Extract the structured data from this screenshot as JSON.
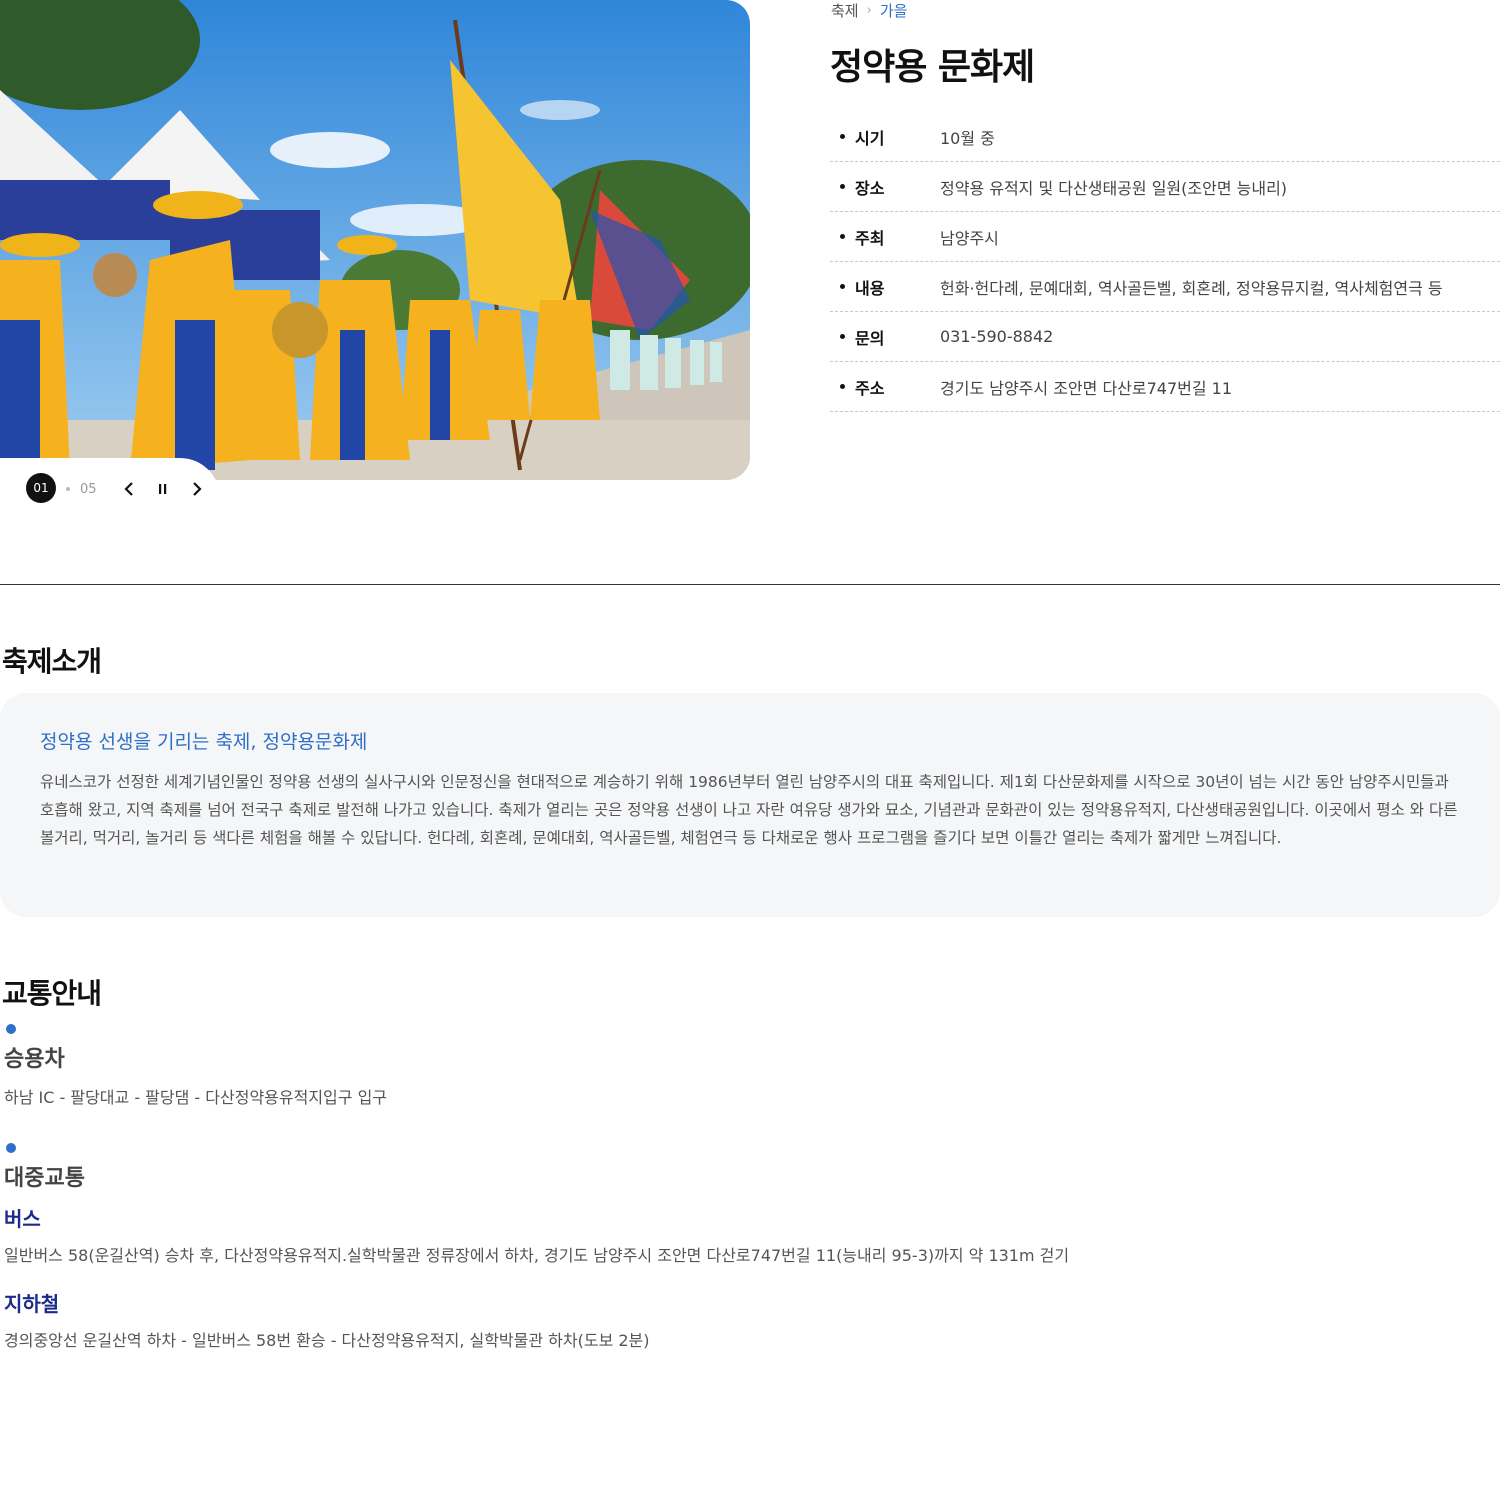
{
  "slider": {
    "current": "01",
    "total": "05",
    "prev_icon": "chevron-left-icon",
    "pause_icon": "pause-icon",
    "next_icon": "chevron-right-icon"
  },
  "breadcrumb": {
    "parent": "축제",
    "current": "가을"
  },
  "title": "정약용 문화제",
  "info": [
    {
      "label": "시기",
      "value": "10월 중"
    },
    {
      "label": "장소",
      "value": "정약용 유적지 및 다산생태공원 일원(조안면 능내리)"
    },
    {
      "label": "주최",
      "value": "남양주시"
    },
    {
      "label": "내용",
      "value": "헌화·헌다례, 문예대회, 역사골든벨, 회혼례, 정약용뮤지컬, 역사체험연극 등"
    },
    {
      "label": "문의",
      "value": "031-590-8842"
    },
    {
      "label": "주소",
      "value": "경기도 남양주시 조안면 다산로747번길 11"
    }
  ],
  "intro": {
    "section_title": "축제소개",
    "heading": "정약용 선생을 기리는 축제, 정약용문화제",
    "text": "유네스코가 선정한 세계기념인물인 정약용 선생의 실사구시와 인문정신을 현대적으로 계승하기 위해 1986년부터 열린 남양주시의 대표 축제입니다. 제1회 다산문화제를 시작으로 30년이 넘는 시간 동안 남양주시민들과 호흡해 왔고, 지역 축제를 넘어 전국구 축제로 발전해 나가고 있습니다. 축제가 열리는 곳은 정약용 선생이 나고 자란 여유당 생가와 묘소, 기념관과 문화관이 있는 정약용유적지, 다산생태공원입니다. 이곳에서 평소 와 다른 볼거리, 먹거리, 놀거리 등 색다른 체험을 해볼 수 있답니다. 헌다례, 회혼례, 문예대회, 역사골든벨, 체험연극 등 다채로운 행사 프로그램을 즐기다 보면 이틀간 열리는 축제가 짧게만 느껴집니다."
  },
  "transport": {
    "section_title": "교통안내",
    "car": {
      "title": "승용차",
      "route": "하남 IC - 팔당대교 - 팔당댐 - 다산정약용유적지입구 입구"
    },
    "public": {
      "title": "대중교통",
      "bus_title": "버스",
      "bus_route": "일반버스 58(운길산역) 승차 후, 다산정약용유적지.실학박물관 정류장에서 하차, 경기도 남양주시 조안면 다산로747번길 11(능내리 95-3)까지 약 131m 걷기",
      "subway_title": "지하철",
      "subway_route": "경의중앙선 운길산역 하차 - 일반버스 58번 환승 - 다산정약용유적지, 실학박물관 하차(도보 2분)"
    }
  },
  "colors": {
    "accent_blue": "#2e6fc7",
    "navy": "#1b2a8c",
    "box_bg": "#f5f6f8"
  }
}
